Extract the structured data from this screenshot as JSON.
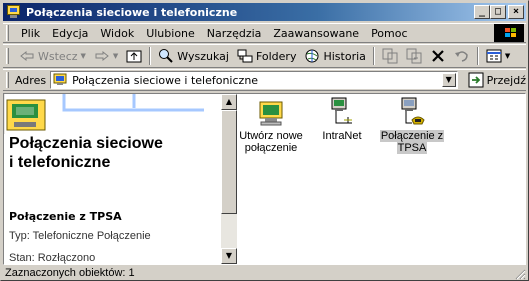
{
  "window": {
    "title": "Połączenia sieciowe i telefoniczne",
    "min_glyph": "_",
    "max_glyph": "□",
    "close_glyph": "×"
  },
  "menu": {
    "items": [
      "Plik",
      "Edycja",
      "Widok",
      "Ulubione",
      "Narzędzia",
      "Zaawansowane",
      "Pomoc"
    ]
  },
  "toolbar": {
    "back_label": "Wstecz",
    "search_label": "Wyszukaj",
    "folders_label": "Foldery",
    "history_label": "Historia"
  },
  "address": {
    "label": "Adres",
    "value": "Połączenia sieciowe i telefoniczne",
    "go_label": "Przejdź"
  },
  "left_panel": {
    "title_line1": "Połączenia sieciowe",
    "title_line2": "i telefoniczne",
    "selected_name": "Połączenie z TPSA",
    "type_line": "Typ: Telefoniczne Połączenie",
    "state_line": "Stan: Rozłączono"
  },
  "icons": [
    {
      "line1": "Utwórz nowe",
      "line2": "połączenie",
      "icon": "new-connection-icon",
      "selected": false
    },
    {
      "line1": "IntraNet",
      "line2": "",
      "icon": "lan-connection-icon",
      "selected": false
    },
    {
      "line1": "Połączenie z",
      "line2": "TPSA",
      "icon": "dialup-connection-icon",
      "selected": true
    }
  ],
  "status": {
    "text": "Zaznaczonych obiektów: 1"
  },
  "colors": {
    "titlebar_start": "#0a246a",
    "titlebar_end": "#a6caf0",
    "face": "#d4d0c8"
  }
}
